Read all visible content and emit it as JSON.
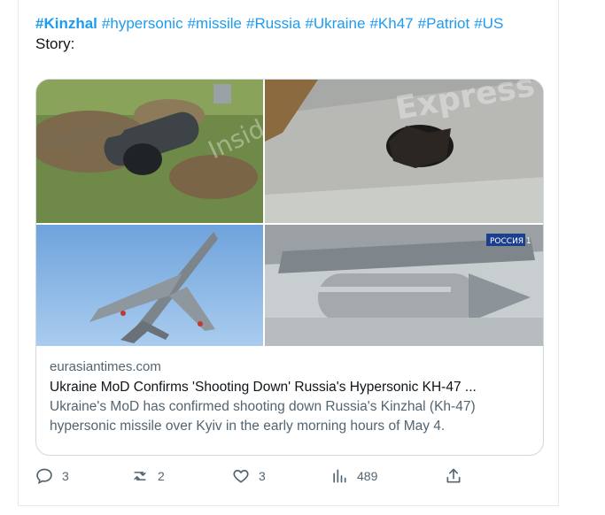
{
  "tweet": {
    "hashtags": [
      "#Kinzhal",
      "#hypersonic",
      "#missile",
      "#Russia",
      "#Ukraine",
      "#Kh47",
      "#Patriot",
      "#US"
    ],
    "body_text": "Story:"
  },
  "card": {
    "images": [
      {
        "icon": "missile-wreck-on-grass-image",
        "watermark": "Insider"
      },
      {
        "icon": "damaged-missile-closeup-image",
        "watermark": "Express"
      },
      {
        "icon": "mig31-jet-in-sky-image"
      },
      {
        "icon": "missile-under-jet-image",
        "badge": "РОССИЯ 1"
      }
    ],
    "domain": "eurasiantimes.com",
    "title": "Ukraine MoD Confirms 'Shooting Down' Russia's Hypersonic KH-47 ...",
    "description": "Ukraine's MoD has confirmed shooting down Russia's Kinzhal (Kh-47) hypersonic missile over Kyiv in the early morning hours of May 4."
  },
  "actions": {
    "reply_count": "3",
    "retweet_count": "2",
    "like_count": "3",
    "views_count": "489"
  },
  "colors": {
    "link": "#1d9bf0",
    "secondary_text": "#536471",
    "border": "#cfd9de"
  }
}
